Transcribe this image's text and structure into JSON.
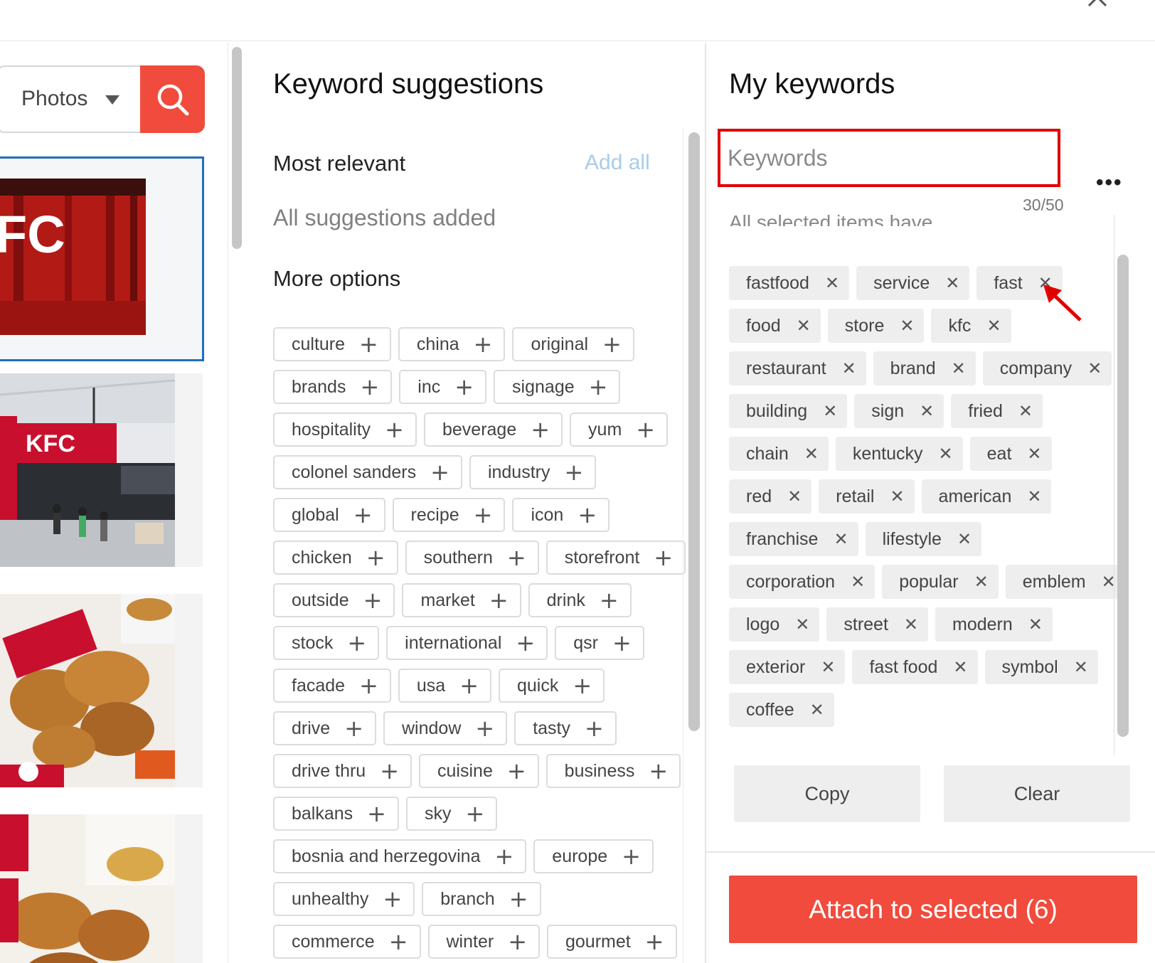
{
  "search": {
    "category": "Photos"
  },
  "middle": {
    "title": "Keyword suggestions",
    "most_relevant": "Most relevant",
    "add_all": "Add all",
    "all_added": "All suggestions added",
    "more_options": "More options",
    "suggestion_rows": [
      [
        "culture",
        "china",
        "original"
      ],
      [
        "brands",
        "inc",
        "signage"
      ],
      [
        "hospitality",
        "beverage",
        "yum"
      ],
      [
        "colonel sanders",
        "industry"
      ],
      [
        "global",
        "recipe",
        "icon"
      ],
      [
        "chicken",
        "southern",
        "storefront"
      ],
      [
        "outside",
        "market",
        "drink"
      ],
      [
        "stock",
        "international",
        "qsr"
      ],
      [
        "facade",
        "usa",
        "quick"
      ],
      [
        "drive",
        "window",
        "tasty"
      ],
      [
        "drive thru",
        "cuisine",
        "business"
      ],
      [
        "balkans",
        "sky"
      ],
      [
        "bosnia and herzegovina",
        "europe"
      ],
      [
        "unhealthy",
        "branch"
      ],
      [
        "commerce",
        "winter",
        "gourmet"
      ]
    ]
  },
  "right": {
    "title": "My keywords",
    "input_placeholder": "Keywords",
    "counter": "30/50",
    "partial_text": "All selected items have",
    "keyword_rows": [
      [
        "fastfood",
        "service",
        "fast"
      ],
      [
        "food",
        "store",
        "kfc"
      ],
      [
        "restaurant",
        "brand",
        "company"
      ],
      [
        "building",
        "sign",
        "fried"
      ],
      [
        "chain",
        "kentucky",
        "eat"
      ],
      [
        "red",
        "retail",
        "american"
      ],
      [
        "franchise",
        "lifestyle"
      ],
      [
        "corporation",
        "popular",
        "emblem"
      ],
      [
        "logo",
        "street",
        "modern"
      ],
      [
        "exterior",
        "fast food",
        "symbol"
      ],
      [
        "coffee"
      ]
    ],
    "copy_label": "Copy",
    "clear_label": "Clear",
    "attach_label": "Attach to selected (6)"
  },
  "colors": {
    "accent": "#f04b3c",
    "selection": "#1f6fbf",
    "highlight": "#e00000"
  },
  "icons": {
    "search": "search-icon",
    "close": "close-icon",
    "more": "more-icon",
    "add": "plus-icon",
    "remove": "x-icon"
  }
}
